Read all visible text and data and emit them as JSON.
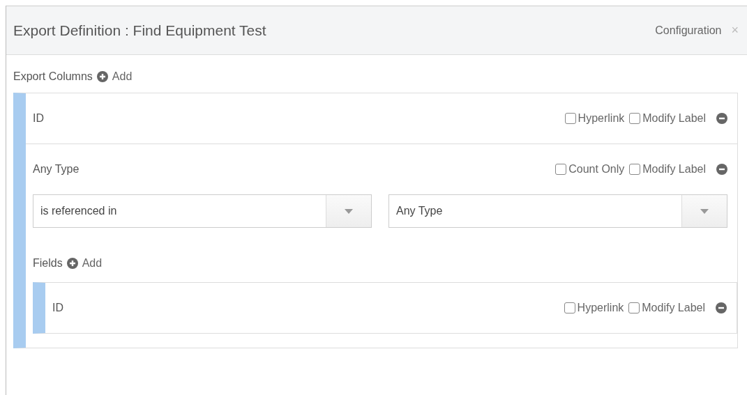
{
  "dialog": {
    "title": "Export Definition : Find Equipment Test",
    "header_link": "Configuration",
    "close": "×"
  },
  "export_columns": {
    "label": "Export Columns",
    "add": "Add"
  },
  "columns": [
    {
      "kind": "simple",
      "label": "ID",
      "options": [
        {
          "label": "Hyperlink",
          "checked": false
        },
        {
          "label": "Modify Label",
          "checked": false
        }
      ]
    },
    {
      "kind": "reference",
      "label": "Any Type",
      "options": [
        {
          "label": "Count Only",
          "checked": false
        },
        {
          "label": "Modify Label",
          "checked": false
        }
      ],
      "selects": [
        {
          "value": "is referenced in"
        },
        {
          "value": "Any Type"
        }
      ],
      "fields": {
        "label": "Fields",
        "add": "Add",
        "items": [
          {
            "kind": "simple",
            "label": "ID",
            "options": [
              {
                "label": "Hyperlink",
                "checked": false
              },
              {
                "label": "Modify Label",
                "checked": false
              }
            ]
          }
        ]
      }
    }
  ]
}
